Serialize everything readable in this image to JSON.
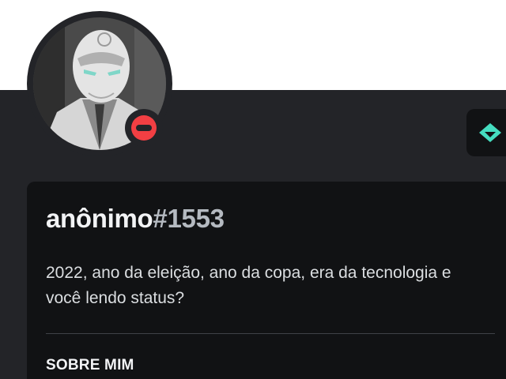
{
  "profile": {
    "username": "anônimo",
    "discriminator": "#1553",
    "custom_status": "2022, ano da eleição, ano da copa, era da tecnologia e você lendo status?",
    "status": "do-not-disturb",
    "badge_icon": "hypesquad-balance-icon"
  },
  "sections": {
    "about_me_title": "SOBRE MIM"
  },
  "colors": {
    "banner": "#ffffff",
    "panel": "#232428",
    "card": "#111214",
    "dnd_status": "#f23f43",
    "badge_accent": "#45ddc0",
    "text_primary": "#f2f3f5",
    "text_secondary": "#b5bac1"
  }
}
